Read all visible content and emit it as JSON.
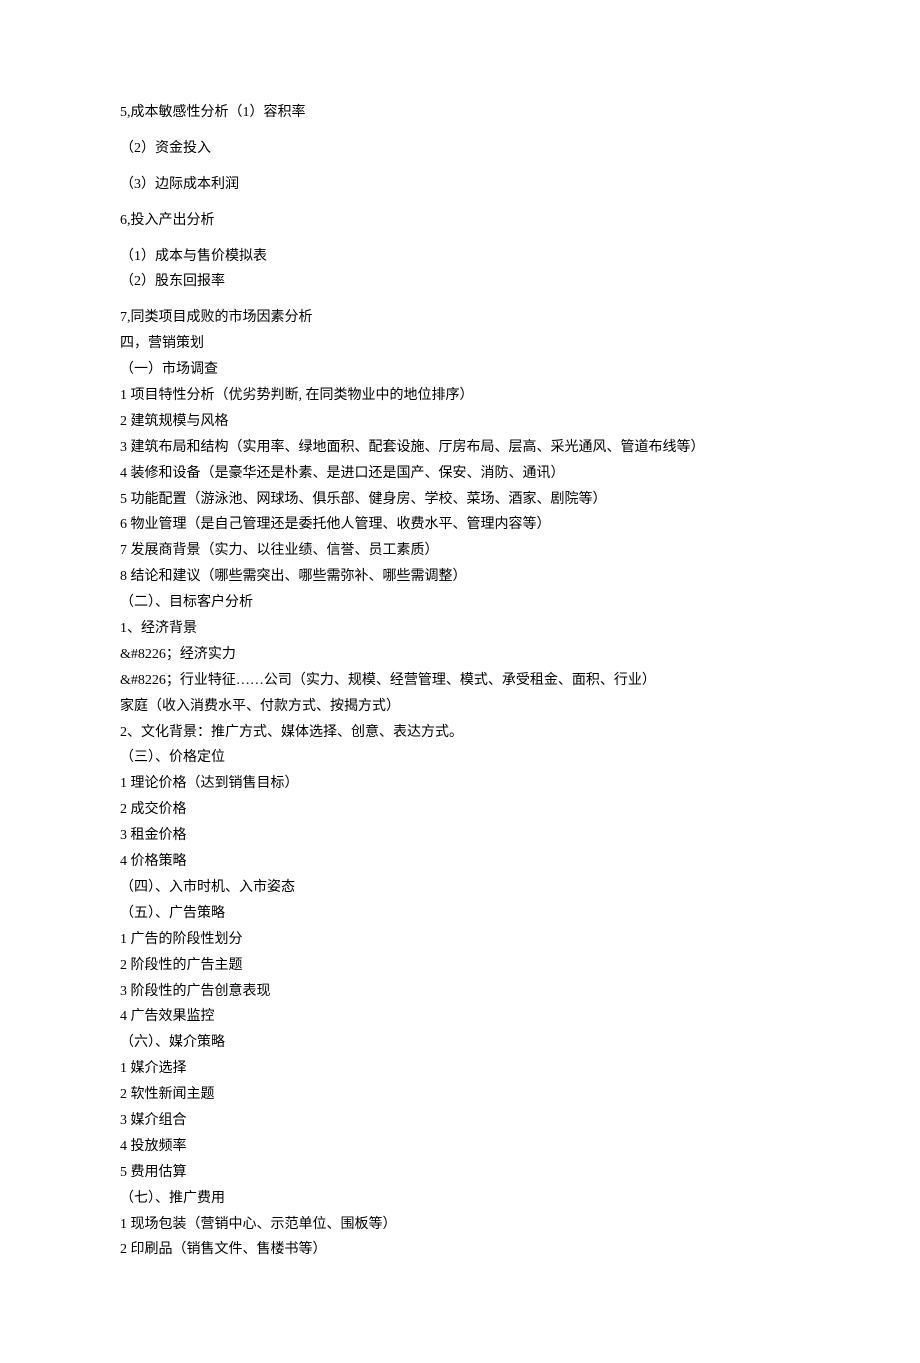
{
  "lines": [
    "5,成本敏感性分析（1）容积率",
    "（2）资金投入",
    "（3）边际成本利润",
    "6,投入产出分析",
    "（1）成本与售价模拟表",
    "（2）股东回报率",
    "7,同类项目成败的市场因素分析",
    "四，营销策划",
    "（一）市场调查",
    "1 项目特性分析（优劣势判断, 在同类物业中的地位排序）",
    "2 建筑规模与风格",
    "3 建筑布局和结构（实用率、绿地面积、配套设施、厅房布局、层高、采光通风、管道布线等）",
    "4 装修和设备（是豪华还是朴素、是进口还是国产、保安、消防、通讯）",
    "5 功能配置（游泳池、网球场、俱乐部、健身房、学校、菜场、酒家、剧院等）",
    "6 物业管理（是自己管理还是委托他人管理、收费水平、管理内容等）",
    "7 发展商背景（实力、以往业绩、信誉、员工素质）",
    "8 结论和建议（哪些需突出、哪些需弥补、哪些需调整）",
    "（二）、目标客户分析",
    "1、经济背景",
    "&#8226；经济实力",
    "&#8226；行业特征……公司（实力、规模、经营管理、模式、承受租金、面积、行业）",
    "家庭（收入消费水平、付款方式、按揭方式）",
    "2、文化背景：推广方式、媒体选择、创意、表达方式。",
    "（三）、价格定位",
    "1 理论价格（达到销售目标）",
    "2 成交价格",
    "3 租金价格",
    "4 价格策略",
    "（四）、入市时机、入市姿态",
    "（五）、广告策略",
    "1 广告的阶段性划分",
    "2 阶段性的广告主题",
    "3 阶段性的广告创意表现",
    "4 广告效果监控",
    "（六）、媒介策略",
    "1 媒介选择",
    "2 软性新闻主题",
    "3 媒介组合",
    "4 投放频率",
    "5 费用估算",
    "（七）、推广费用",
    "1 现场包装（营销中心、示范单位、围板等）",
    "2 印刷品（销售文件、售楼书等）"
  ],
  "spacedAfter": [
    0,
    1,
    2,
    3,
    5
  ]
}
